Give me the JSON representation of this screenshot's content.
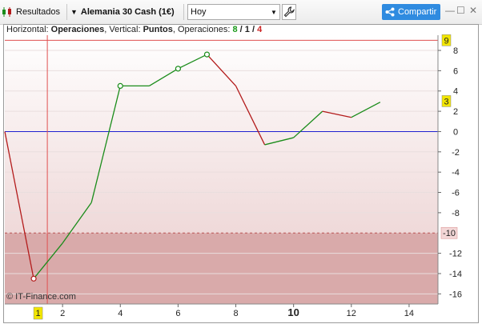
{
  "toolbar": {
    "results_label": "Resultados",
    "instrument": "Alemania 30 Cash (1€)",
    "period_value": "Hoy",
    "share_label": "Compartir",
    "minimize": "—",
    "maximize": "☐",
    "close": "✕"
  },
  "legend": {
    "horizontal_label": "Horizontal:",
    "horizontal_value": "Operaciones",
    "vertical_label": ", Vertical:",
    "vertical_value": "Puntos",
    "ops_label": ", Operaciones:",
    "wins": "8",
    "sep1": "/",
    "neutral": "1",
    "sep2": "/",
    "losses": "4"
  },
  "watermark": "© IT-Finance.com",
  "colors": {
    "up": "#1a8c1a",
    "down": "#b31b1b",
    "zero_line": "#2020d0",
    "drawdown_zone": "#d9aaaa",
    "marker": "#1a8c1a",
    "badge": "#f2e600"
  },
  "chart_data": {
    "type": "line",
    "x": [
      0,
      1,
      2,
      3,
      4,
      5,
      6,
      7,
      8,
      9,
      10,
      11,
      12,
      13
    ],
    "y": [
      0,
      -14.5,
      -11,
      -7,
      4.5,
      4.5,
      6.2,
      7.6,
      4.5,
      -1.3,
      -0.6,
      2,
      1.4,
      2.9
    ],
    "markers_at_x": [
      1,
      4,
      6,
      7
    ],
    "xlim": [
      0,
      15
    ],
    "ylim": [
      -17,
      9.5
    ],
    "x_ticks": [
      {
        "v": 2,
        "label": "2"
      },
      {
        "v": 4,
        "label": "4"
      },
      {
        "v": 6,
        "label": "6"
      },
      {
        "v": 8,
        "label": "8"
      },
      {
        "v": 10,
        "label": "10"
      },
      {
        "v": 12,
        "label": "12"
      },
      {
        "v": 14,
        "label": "14"
      }
    ],
    "x_badge": {
      "v": 1,
      "label": "1"
    },
    "y_ticks": [
      {
        "v": 8,
        "label": "8"
      },
      {
        "v": 6,
        "label": "6"
      },
      {
        "v": 4,
        "label": "4"
      },
      {
        "v": 2,
        "label": "2"
      },
      {
        "v": 0,
        "label": "0"
      },
      {
        "v": -2,
        "label": "-2"
      },
      {
        "v": -4,
        "label": "-4"
      },
      {
        "v": -6,
        "label": "-6"
      },
      {
        "v": -8,
        "label": "-8"
      },
      {
        "v": -12,
        "label": "-12"
      },
      {
        "v": -14,
        "label": "-14"
      },
      {
        "v": -16,
        "label": "-16"
      }
    ],
    "y_badges": [
      {
        "v": 9,
        "label": "9"
      },
      {
        "v": 3,
        "label": "3"
      }
    ],
    "max_level": 9,
    "drawdown_level": -10,
    "drawdown_label": "-10",
    "vertical_marker_x": 1.5
  }
}
